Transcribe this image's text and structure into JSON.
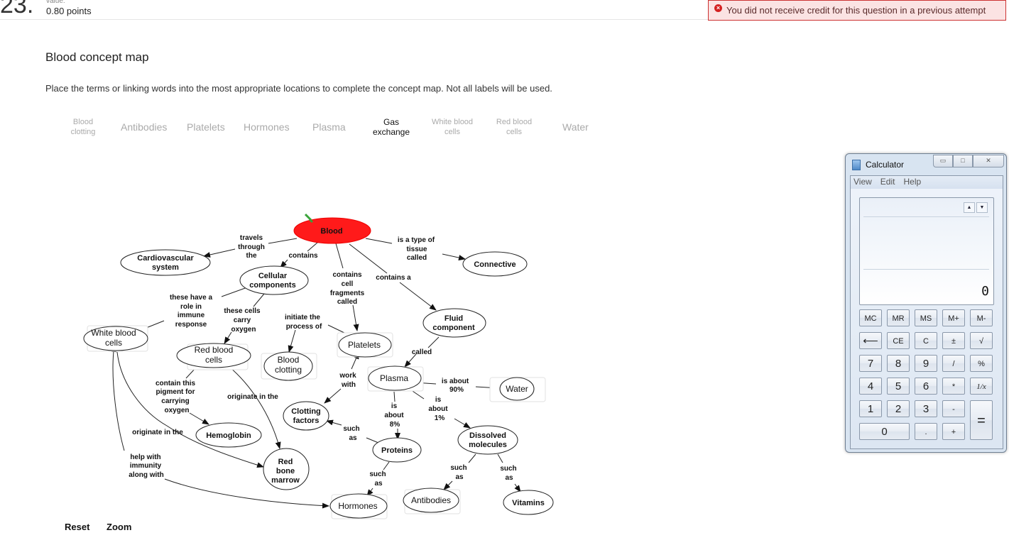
{
  "question": {
    "number": "23.",
    "value_label": "value:",
    "points": "0.80 points",
    "alert": "You did not receive credit for this question in a previous attempt",
    "title": "Blood concept map",
    "instructions": "Place the terms or linking words into the most appropriate locations to complete the concept map. Not all labels will be used."
  },
  "label_bank": [
    {
      "line1": "Blood",
      "line2": "clotting",
      "state": "placed"
    },
    {
      "line1": "Antibodies",
      "line2": "",
      "state": "placed"
    },
    {
      "line1": "Platelets",
      "line2": "",
      "state": "placed"
    },
    {
      "line1": "Hormones",
      "line2": "",
      "state": "placed"
    },
    {
      "line1": "Plasma",
      "line2": "",
      "state": "placed"
    },
    {
      "line1": "Gas",
      "line2": "exchange",
      "state": "available"
    },
    {
      "line1": "White blood",
      "line2": "cells",
      "state": "placed"
    },
    {
      "line1": "Red blood",
      "line2": "cells",
      "state": "placed"
    },
    {
      "line1": "Water",
      "line2": "",
      "state": "placed"
    }
  ],
  "concept_map": {
    "nodes": {
      "blood": "Blood",
      "cardio1": "Cardiovascular",
      "cardio2": "system",
      "connective": "Connective",
      "cell1": "Cellular",
      "cell2": "components",
      "fluid1": "Fluid",
      "fluid2": "component",
      "wbc1": "White blood",
      "wbc2": "cells",
      "rbc1": "Red blood",
      "rbc2": "cells",
      "clot1": "Blood",
      "clot2": "clotting",
      "platelets": "Platelets",
      "plasma": "Plasma",
      "water": "Water",
      "cf1": "Clotting",
      "cf2": "factors",
      "hemoglobin": "Hemoglobin",
      "proteins": "Proteins",
      "dm1": "Dissolved",
      "dm2": "molecules",
      "rbm1": "Red",
      "rbm2": "bone",
      "rbm3": "marrow",
      "hormones": "Hormones",
      "antibodies": "Antibodies",
      "vitamins": "Vitamins"
    },
    "links": {
      "travels": [
        "travels",
        "through",
        "the"
      ],
      "contains": [
        "contains"
      ],
      "type_of": [
        "is a type of",
        "tissue",
        "called"
      ],
      "cell_fragments": [
        "contains",
        "cell",
        "fragments",
        "called"
      ],
      "contains_a": [
        "contains a"
      ],
      "immune": [
        "these have a",
        "role in",
        "immune",
        "response"
      ],
      "carry": [
        "these cells",
        "carry",
        "oxygen"
      ],
      "initiate": [
        "initiate the",
        "process of"
      ],
      "called": [
        "called"
      ],
      "pigment": [
        "contain this",
        "pigment for",
        "carrying",
        "oxygen"
      ],
      "orig_rbc": [
        "originate in the"
      ],
      "orig_wbc": [
        "originate in the"
      ],
      "immunity": [
        "help with",
        "immunity",
        "along with"
      ],
      "work_with": [
        "work",
        "with"
      ],
      "pct90": [
        "is about",
        "90%"
      ],
      "pct8": [
        "is",
        "about",
        "8%"
      ],
      "pct1": [
        "is",
        "about",
        "1%"
      ],
      "such_cf": [
        "such",
        "as"
      ],
      "such_horm": [
        "such",
        "as"
      ],
      "such_anti": [
        "such",
        "as"
      ],
      "such_vit": [
        "such",
        "as"
      ]
    }
  },
  "controls": {
    "reset": "Reset",
    "zoom": "Zoom"
  },
  "calculator": {
    "title": "Calculator",
    "menu": [
      "View",
      "Edit",
      "Help"
    ],
    "display": "0",
    "keys": {
      "mc": "MC",
      "mr": "MR",
      "ms": "MS",
      "mplus": "M+",
      "mminus": "M-",
      "back": "⟵",
      "ce": "CE",
      "c": "C",
      "pm": "±",
      "sqrt": "√",
      "k7": "7",
      "k8": "8",
      "k9": "9",
      "div": "/",
      "pct": "%",
      "k4": "4",
      "k5": "5",
      "k6": "6",
      "mul": "*",
      "inv": "1/x",
      "k1": "1",
      "k2": "2",
      "k3": "3",
      "sub": "-",
      "eq": "=",
      "k0": "0",
      "dot": ".",
      "add": "+"
    }
  },
  "colors": {
    "blood_node": "#ff1a1a",
    "alert_bg": "#fbe3e3",
    "alert_border": "#cc3333"
  }
}
